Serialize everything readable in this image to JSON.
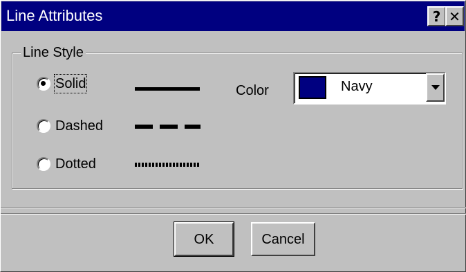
{
  "window": {
    "title": "Line Attributes",
    "help_glyph": "?",
    "close_glyph": "✕",
    "help_icon": "question-mark-icon",
    "close_icon": "close-icon"
  },
  "line_style": {
    "group_label": "Line Style",
    "options": [
      {
        "label": "Solid",
        "checked": true,
        "sample": "solid"
      },
      {
        "label": "Dashed",
        "checked": false,
        "sample": "dashed"
      },
      {
        "label": "Dotted",
        "checked": false,
        "sample": "dotted"
      }
    ]
  },
  "color": {
    "label": "Color",
    "selected": "Navy",
    "swatch_color": "#000080",
    "dropdown_icon": "chevron-down-icon"
  },
  "buttons": {
    "ok": "OK",
    "cancel": "Cancel"
  },
  "theme": {
    "titlebar": "#000080",
    "face": "#c0c0c0"
  }
}
